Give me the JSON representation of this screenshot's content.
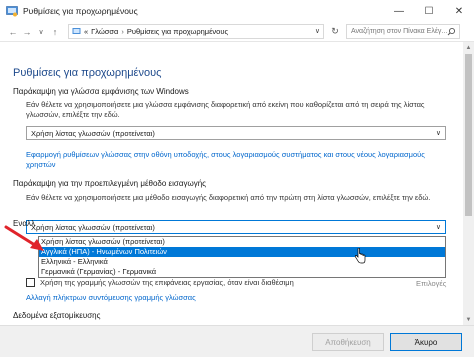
{
  "window": {
    "title": "Ρυθμίσεις για προχωρημένους",
    "controls": {
      "minimize": "—",
      "maximize": "☐",
      "close": "✕"
    }
  },
  "address_bar": {
    "back": "←",
    "forward": "→",
    "up": "↑",
    "root_marker": "«",
    "crumbs": [
      "Γλώσσα",
      "Ρυθμίσεις για προχωρημένους"
    ],
    "separator": "›",
    "dropdown": "∨",
    "refresh": "↻",
    "search_placeholder": "Αναζήτηση στον Πίνακα Ελέγ..."
  },
  "main": {
    "page_title": "Ρυθμίσεις για προχωρημένους",
    "display_override": {
      "heading": "Παράκαμψη για γλώσσα εμφάνισης των Windows",
      "description": "Εάν θέλετε να χρησιμοποιήσετε μια γλώσσα εμφάνισης διαφορετική από εκείνη που καθορίζεται από τη σειρά της λίστας γλωσσών, επιλέξτε την εδώ.",
      "combo_value": "Χρήση λίστας γλωσσών (προτείνεται)",
      "link": "Εφαρμογή ρυθμίσεων γλώσσας στην οθόνη υποδοχής, στους λογαριασμούς συστήματος και στους νέους λογαριασμούς χρηστών"
    },
    "input_override": {
      "heading": "Παράκαμψη για την προεπιλεγμένη μέθοδο εισαγωγής",
      "description": "Εάν θέλετε να χρησιμοποιήσετε μια μέθοδο εισαγωγής διαφορετική από την πρώτη στη λίστα γλωσσών, επιλέξτε την εδώ.",
      "combo_value": "Χρήση λίστας γλωσσών (προτείνεται)",
      "options": [
        "Χρήση λίστας γλωσσών (προτείνεται)",
        "Αγγλικά (ΗΠΑ) - Ηνωμένων Πολιτειών",
        "Ελληνικά - Ελληνικά",
        "Γερμανικά (Γερμανίας) - Γερμανικά"
      ],
      "selected_index": 1
    },
    "switching": {
      "heading_partial": "Εναλλ",
      "checkbox_label": "Χρήση της γραμμής γλωσσών της επιφάνειας εργασίας, όταν είναι διαθέσιμη",
      "options_link": "Επιλογές",
      "hotkeys_link": "Αλλαγή πλήκτρων συντόμευσης γραμμής γλώσσας"
    },
    "personalization_heading": "Δεδομένα εξατομίκευσης"
  },
  "footer": {
    "cancel": "Αποθήκευση",
    "ok": "Άκυρο"
  },
  "colors": {
    "accent": "#0078d7",
    "title_blue": "#1e4a8c",
    "link": "#0066cc",
    "annotation_red": "#e0242b"
  }
}
